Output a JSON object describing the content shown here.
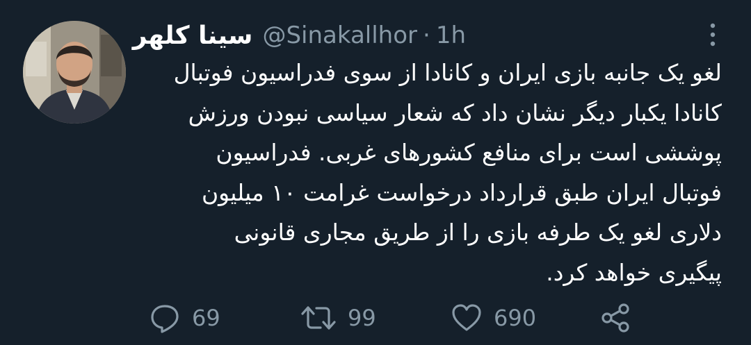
{
  "tweet": {
    "display_name": "سینا کلهر",
    "handle": "@Sinakallhor",
    "separator": "·",
    "time": "1h",
    "text_lines": [
      "لغو یک جانبه بازی ایران و کانادا از سوی فدراسیون فوتبال",
      "کانادا یکبار دیگر نشان داد که شعار سیاسی نبودن ورزش",
      "پوششی است برای منافع کشورهای غربی. فدراسیون",
      "فوتبال ایران طبق قرارداد درخواست غرامت ۱۰ میلیون",
      "دلاری لغو یک طرفه بازی را از طریق مجاری قانونی",
      "پیگیری خواهد کرد."
    ]
  },
  "actions": {
    "reply": {
      "icon": "reply-icon",
      "count": "69"
    },
    "retweet": {
      "icon": "retweet-icon",
      "count": "99"
    },
    "like": {
      "icon": "heart-icon",
      "count": "690"
    },
    "share": {
      "icon": "share-icon"
    }
  },
  "colors": {
    "background": "#15202b",
    "primary_text": "#ffffff",
    "secondary_text": "#8899a6"
  }
}
